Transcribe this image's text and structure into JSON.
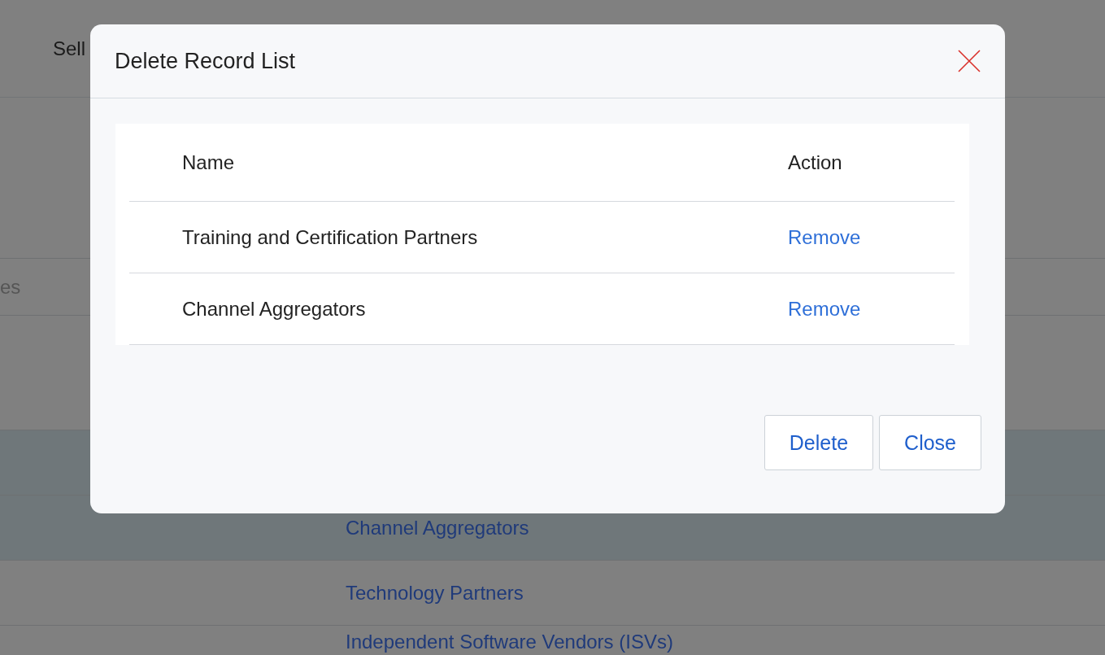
{
  "background": {
    "header_text": "Sell",
    "field_text": "es",
    "rows": [
      {
        "selected": true
      },
      {
        "label": "Channel Aggregators",
        "selected": true
      },
      {
        "label": "Technology Partners",
        "selected": false
      },
      {
        "label": "Independent Software Vendors (ISVs)",
        "selected": false
      }
    ]
  },
  "dialog": {
    "title": "Delete Record List",
    "columns": [
      "Name",
      "Action"
    ],
    "rows": [
      {
        "name": "Training and Certification Partners",
        "action": "Remove"
      },
      {
        "name": "Channel Aggregators",
        "action": "Remove"
      }
    ],
    "buttons": [
      "Delete",
      "Close"
    ]
  }
}
